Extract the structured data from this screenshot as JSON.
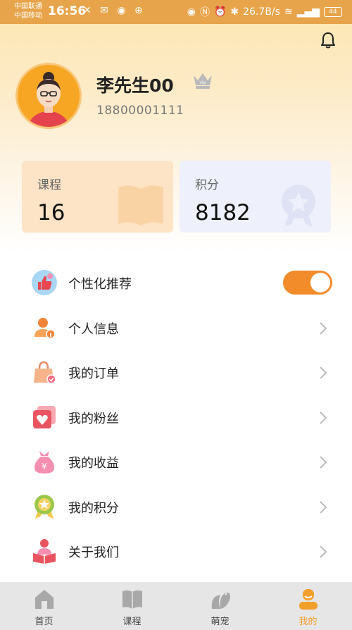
{
  "status_bar": {
    "carrier_1": "中国联通",
    "carrier_2": "中国移动",
    "time": "16:56",
    "net_speed": "26.7B/s",
    "battery": "44"
  },
  "profile": {
    "name": "李先生00",
    "phone": "18800001111",
    "vip_label": "vip"
  },
  "stats": {
    "course_label": "课程",
    "course_value": "16",
    "points_label": "积分",
    "points_value": "8182"
  },
  "menu": [
    {
      "label": "个性化推荐",
      "icon": "thumbs-up-icon",
      "toggle_on": true
    },
    {
      "label": "个人信息",
      "icon": "person-info-icon"
    },
    {
      "label": "我的订单",
      "icon": "shopping-bag-icon"
    },
    {
      "label": "我的粉丝",
      "icon": "heart-cards-icon"
    },
    {
      "label": "我的收益",
      "icon": "money-bag-icon"
    },
    {
      "label": "我的积分",
      "icon": "medal-icon"
    },
    {
      "label": "关于我们",
      "icon": "reading-person-icon"
    }
  ],
  "tabs": [
    {
      "label": "首页",
      "icon": "home-icon",
      "active": false
    },
    {
      "label": "课程",
      "icon": "book-icon",
      "active": false
    },
    {
      "label": "萌宠",
      "icon": "pet-leaf-icon",
      "active": false
    },
    {
      "label": "我的",
      "icon": "profile-icon",
      "active": true
    }
  ],
  "colors": {
    "accent": "#f28b2a",
    "status_bar": "#e7a44a",
    "active_tab": "#f0a02a"
  }
}
